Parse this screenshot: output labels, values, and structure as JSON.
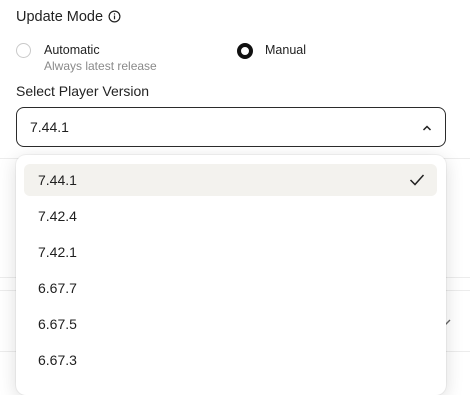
{
  "header": {
    "title": "Update Mode",
    "info_icon": "info-icon"
  },
  "update_mode": {
    "options": [
      {
        "label": "Automatic",
        "sublabel": "Always latest release",
        "selected": false
      },
      {
        "label": "Manual",
        "selected": true
      }
    ]
  },
  "version_select": {
    "label": "Select Player Version",
    "value": "7.44.1",
    "expanded": true,
    "options": [
      "7.44.1",
      "7.42.4",
      "7.42.1",
      "6.67.7",
      "6.67.5",
      "6.67.3"
    ],
    "selected_index": 0
  },
  "colors": {
    "accent": "#111111",
    "selected_bg": "#f3f2ee",
    "border": "#2b2b2b"
  }
}
